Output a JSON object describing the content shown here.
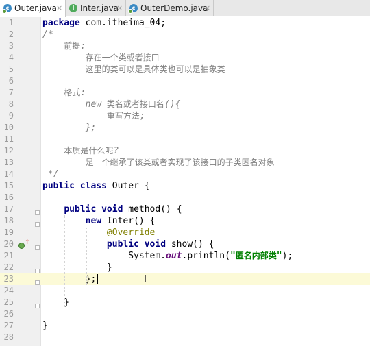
{
  "tabs": [
    {
      "label": "Outer.java",
      "icon": "class-icon",
      "icon_letter": "c",
      "active": true
    },
    {
      "label": "Inter.java",
      "icon": "interface-icon",
      "icon_letter": "I",
      "active": false
    },
    {
      "label": "OuterDemo.java",
      "icon": "class-icon",
      "icon_letter": "c",
      "active": false
    }
  ],
  "tab_close_glyph": "×",
  "editor": {
    "current_line": 23,
    "lines": [
      {
        "n": "1",
        "t": "package com.itheima_04;"
      },
      {
        "n": "2",
        "t": "/*"
      },
      {
        "n": "3",
        "t": "    前提:"
      },
      {
        "n": "4",
        "t": "        存在一个类或者接口"
      },
      {
        "n": "5",
        "t": "        这里的类可以是具体类也可以是抽象类"
      },
      {
        "n": "6",
        "t": ""
      },
      {
        "n": "7",
        "t": "    格式:"
      },
      {
        "n": "8",
        "t": "        new 类名或者接口名(){"
      },
      {
        "n": "9",
        "t": "            重写方法;"
      },
      {
        "n": "10",
        "t": "        };"
      },
      {
        "n": "11",
        "t": ""
      },
      {
        "n": "12",
        "t": "    本质是什么呢?"
      },
      {
        "n": "13",
        "t": "        是一个继承了该类或者实现了该接口的子类匿名对象"
      },
      {
        "n": "14",
        "t": " */"
      },
      {
        "n": "15",
        "t": "public class Outer {"
      },
      {
        "n": "16",
        "t": ""
      },
      {
        "n": "17",
        "t": "    public void method() {"
      },
      {
        "n": "18",
        "t": "        new Inter() {"
      },
      {
        "n": "19",
        "t": "            @Override"
      },
      {
        "n": "20",
        "t": "            public void show() {"
      },
      {
        "n": "21",
        "t": "                System.out.println(\"匿名内部类\");"
      },
      {
        "n": "22",
        "t": "            }"
      },
      {
        "n": "23",
        "t": "        };"
      },
      {
        "n": "24",
        "t": ""
      },
      {
        "n": "25",
        "t": "    }"
      },
      {
        "n": "26",
        "t": ""
      },
      {
        "n": "27",
        "t": "}"
      },
      {
        "n": "28",
        "t": ""
      }
    ]
  },
  "colors": {
    "keyword": "#000080",
    "comment": "#808080",
    "annotation": "#808000",
    "string": "#008000",
    "static_field": "#660e7a",
    "current_line_bg": "#fcfad7"
  }
}
